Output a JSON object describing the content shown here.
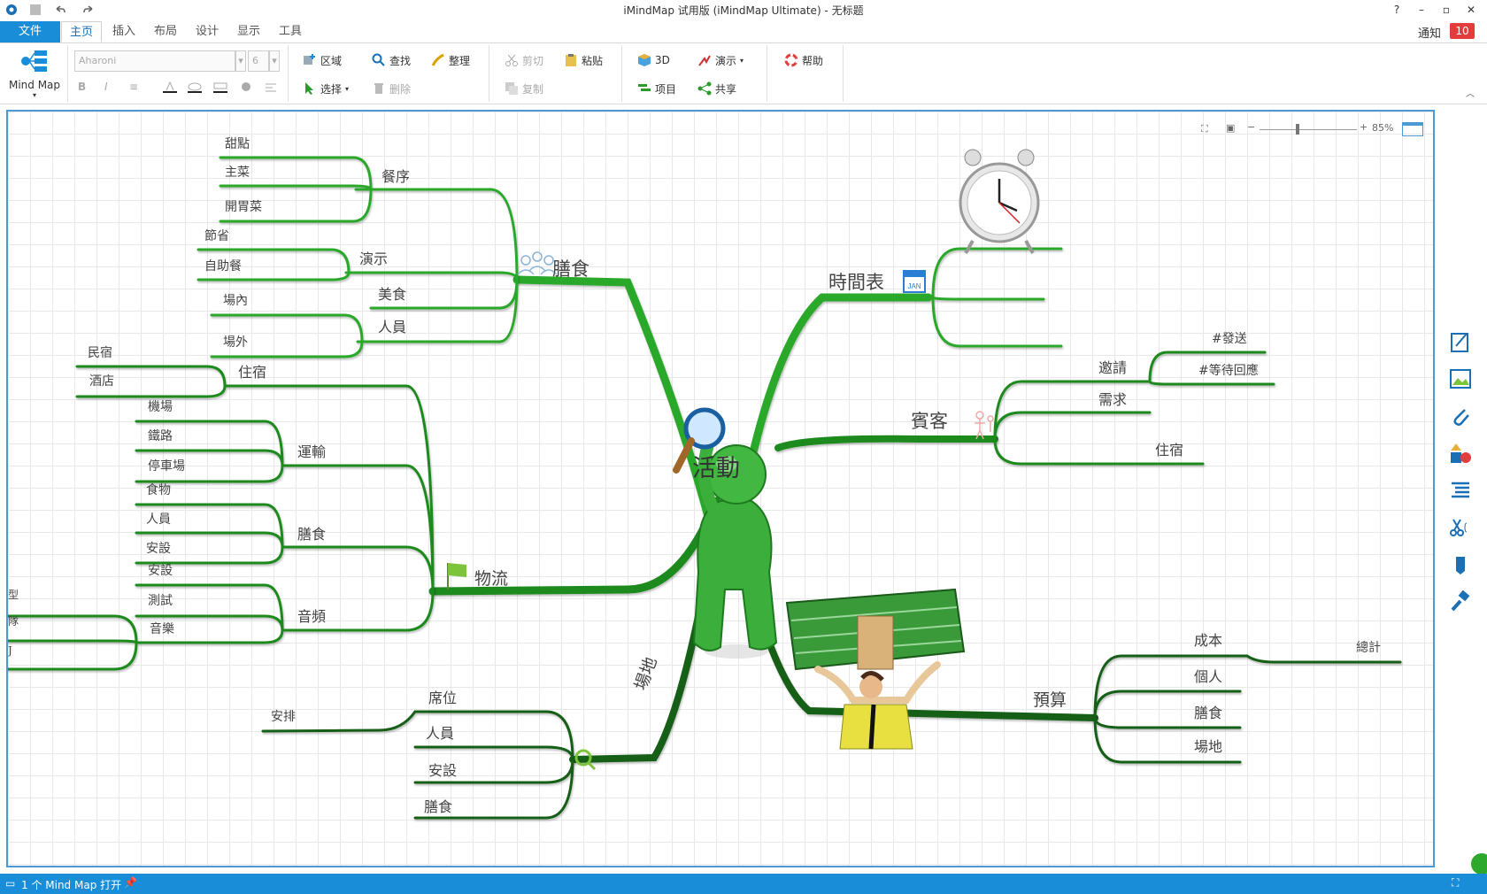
{
  "app": {
    "title": "iMindMap 试用版 (iMindMap Ultimate) - 无标题"
  },
  "window_controls": {
    "help": "?",
    "minimize": "–",
    "restore": "▫",
    "close": "✕"
  },
  "tabs": [
    {
      "label": "文件"
    },
    {
      "label": "主页"
    },
    {
      "label": "插入"
    },
    {
      "label": "布局"
    },
    {
      "label": "设计"
    },
    {
      "label": "显示"
    },
    {
      "label": "工具"
    }
  ],
  "notify": {
    "label": "通知",
    "count": "10"
  },
  "ribbon": {
    "mindmap_label": "Mind Map",
    "font_name": "Aharoni",
    "font_size": "6",
    "region": "区域",
    "find": "查找",
    "tidy": "整理",
    "select": "选择",
    "delete": "删除",
    "cut": "剪切",
    "paste": "粘贴",
    "copy": "复制",
    "three_d": "3D",
    "present": "演示",
    "project": "项目",
    "share": "共享",
    "help": "帮助"
  },
  "zoom": {
    "level": "85%",
    "value": 0.85
  },
  "map": {
    "central": "活動",
    "meals": {
      "label": "膳食",
      "order": "餐序",
      "dessert": "甜點",
      "main_dish": "主菜",
      "appetizer": "開胃菜",
      "show": "演示",
      "save": "節省",
      "buffet": "自助餐",
      "food": "美食",
      "staff": "人員",
      "indoor": "場內",
      "outdoor": "場外"
    },
    "schedule": {
      "label": "時間表",
      "calendar_text": "JAN"
    },
    "guests": {
      "label": "賓客",
      "invite": "邀請",
      "send": "#發送",
      "waiting": "#等待回應",
      "needs": "需求",
      "lodging": "住宿"
    },
    "logistics": {
      "label": "物流",
      "lodging": "住宿",
      "bnb": "民宿",
      "hotel": "酒店",
      "transport": "運輸",
      "airport": "機場",
      "railway": "鐵路",
      "parking": "停車場",
      "meals": "膳食",
      "food": "食物",
      "staff": "人員",
      "setup": "安設",
      "audio": "音頻",
      "audio_setup": "安設",
      "test": "測試",
      "music": "音樂",
      "cut_type": "型",
      "cut_team": "隊",
      "cut_j": "J"
    },
    "venue": {
      "label": "場地",
      "seats": "席位",
      "arrange": "安排",
      "staff": "人員",
      "setup": "安設",
      "meals": "膳食"
    },
    "budget": {
      "label": "預算",
      "cost": "成本",
      "total": "總計",
      "individual": "個人",
      "meals": "膳食",
      "venue": "場地"
    }
  },
  "status": {
    "text": "1 个 Mind Map 打开"
  }
}
